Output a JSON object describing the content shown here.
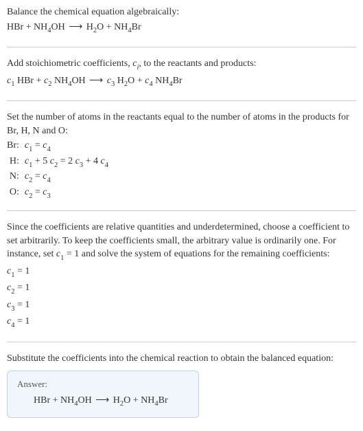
{
  "section1": {
    "line1": "Balance the chemical equation algebraically:",
    "eq_lhs1": "HBr + NH",
    "eq_sub1": "4",
    "eq_mid1": "OH",
    "arrow": "⟶",
    "eq_rhs1": "H",
    "eq_sub2": "2",
    "eq_rhs2": "O + NH",
    "eq_sub3": "4",
    "eq_rhs3": "Br"
  },
  "section2": {
    "line1a": "Add stoichiometric coefficients, ",
    "ci": "c",
    "ci_sub": "i",
    "line1b": ", to the reactants and products:",
    "c1": "c",
    "s1": "1",
    "sp1": " HBr + ",
    "c2": "c",
    "s2": "2",
    "sp2": " NH",
    "s2b": "4",
    "sp2b": "OH",
    "arrow": "⟶",
    "c3": "c",
    "s3": "3",
    "sp3": " H",
    "s3b": "2",
    "sp3b": "O + ",
    "c4": "c",
    "s4": "4",
    "sp4": " NH",
    "s4b": "4",
    "sp4b": "Br"
  },
  "section3": {
    "intro": "Set the number of atoms in the reactants equal to the number of atoms in the products for Br, H, N and O:",
    "rows": [
      {
        "label": "Br:",
        "eq_parts": [
          "c",
          "1",
          " = ",
          "c",
          "4"
        ]
      },
      {
        "label": "H:",
        "eq_parts": [
          "c",
          "1",
          " + 5 ",
          "c",
          "2",
          " = 2 ",
          "c",
          "3",
          " + 4 ",
          "c",
          "4"
        ]
      },
      {
        "label": "N:",
        "eq_parts": [
          "c",
          "2",
          " = ",
          "c",
          "4"
        ]
      },
      {
        "label": "O:",
        "eq_parts": [
          "c",
          "2",
          " = ",
          "c",
          "3"
        ]
      }
    ]
  },
  "section4": {
    "intro_a": "Since the coefficients are relative quantities and underdetermined, choose a coefficient to set arbitrarily. To keep the coefficients small, the arbitrary value is ordinarily one. For instance, set ",
    "set_c": "c",
    "set_sub": "1",
    "intro_b": " = 1 and solve the system of equations for the remaining coefficients:",
    "lines": [
      {
        "c": "c",
        "s": "1",
        "v": " = 1"
      },
      {
        "c": "c",
        "s": "2",
        "v": " = 1"
      },
      {
        "c": "c",
        "s": "3",
        "v": " = 1"
      },
      {
        "c": "c",
        "s": "4",
        "v": " = 1"
      }
    ]
  },
  "section5": {
    "intro": "Substitute the coefficients into the chemical reaction to obtain the balanced equation:",
    "answer_label": "Answer:",
    "eq": {
      "a": "HBr + NH",
      "s1": "4",
      "b": "OH",
      "arrow": "⟶",
      "c": "H",
      "s2": "2",
      "d": "O + NH",
      "s3": "4",
      "e": "Br"
    }
  }
}
